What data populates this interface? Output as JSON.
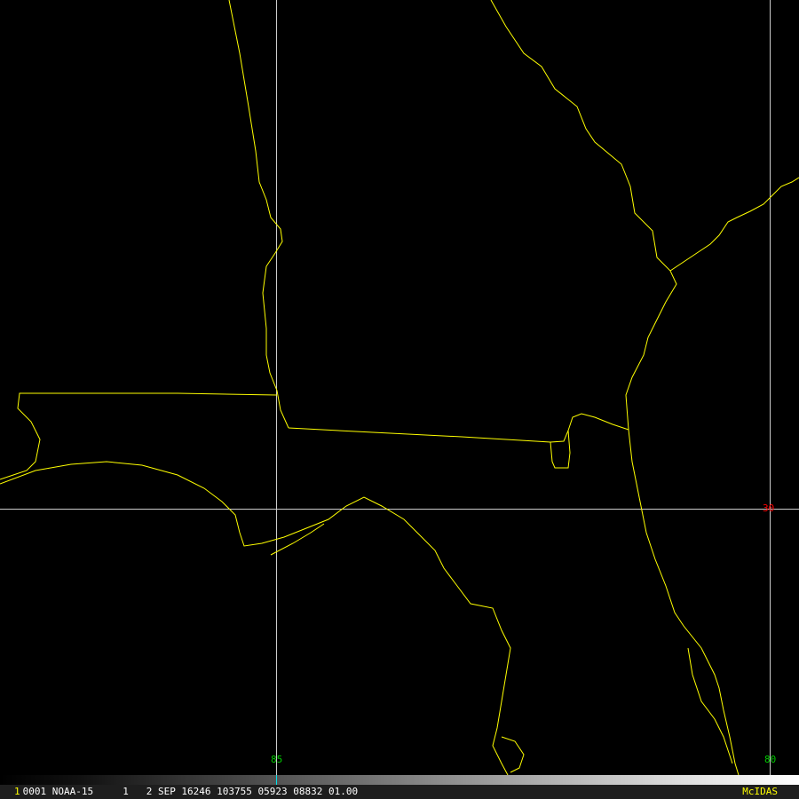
{
  "map": {
    "grid_labels": {
      "lon_85": "85",
      "lon_80": "80",
      "lat_30": "30"
    },
    "colors": {
      "coast": "#ffff00",
      "grid": "#cccccc",
      "lon_label": "#00cc00",
      "lat_label": "#ff0000",
      "cursor": "#00e5ee"
    }
  },
  "status_bar": {
    "frame": "1",
    "info": "0001 NOAA-15     1   2 SEP 16246 103755 05923 08832 01.00",
    "brand": "McIDAS"
  }
}
